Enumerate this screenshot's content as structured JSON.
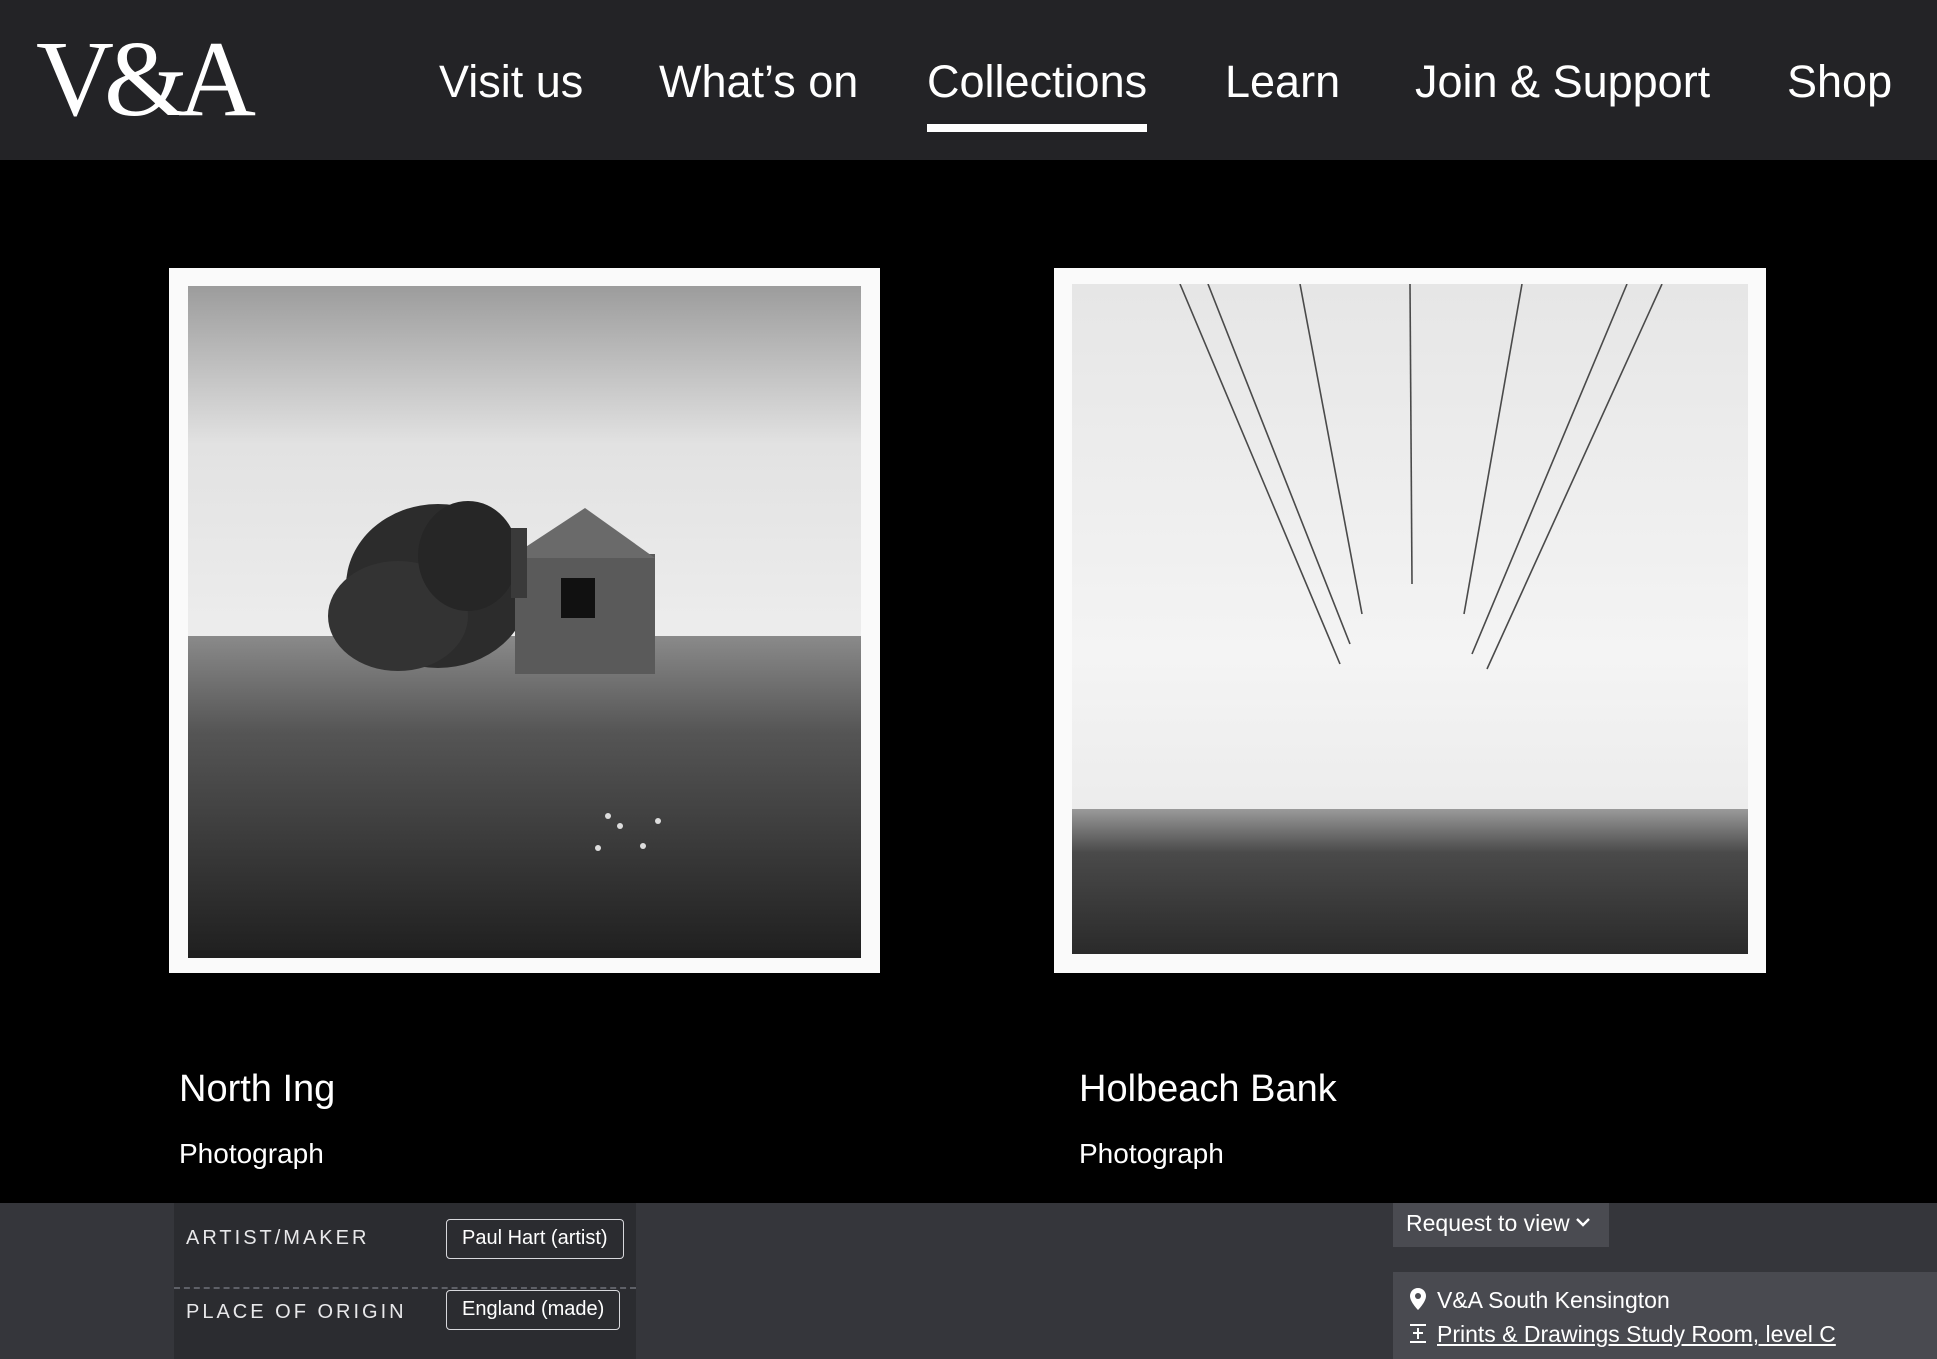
{
  "header": {
    "logo_text": "V&A",
    "nav": [
      {
        "label": "Visit us"
      },
      {
        "label": "What’s on"
      },
      {
        "label": "Collections",
        "active": true
      },
      {
        "label": "Learn"
      },
      {
        "label": "Join & Support"
      },
      {
        "label": "Shop"
      }
    ]
  },
  "cards": [
    {
      "title": "North Ing",
      "type": "Photograph",
      "image": "black-and-white photograph of a derelict brick house beside a tree in a grassy field"
    },
    {
      "title": "Holbeach Bank",
      "type": "Photograph",
      "image": "black-and-white photograph of power lines converging into fog over a flat field"
    }
  ],
  "details": {
    "rows": [
      {
        "label": "ARTIST/MAKER",
        "value": "Paul Hart (artist)"
      },
      {
        "label": "PLACE OF ORIGIN",
        "value": "England (made)"
      }
    ],
    "request_label": "Request to view",
    "location": {
      "venue": "V&A South Kensington",
      "room": "Prints & Drawings Study Room, level C"
    }
  },
  "colors": {
    "header_bg": "#232326",
    "page_bg": "#000000",
    "details_bg": "#35363b",
    "panel_bg": "#2b2c30",
    "button_bg": "#4a4b51"
  },
  "icons": [
    "chevron-down-icon",
    "map-pin-icon",
    "stairs-level-icon"
  ]
}
